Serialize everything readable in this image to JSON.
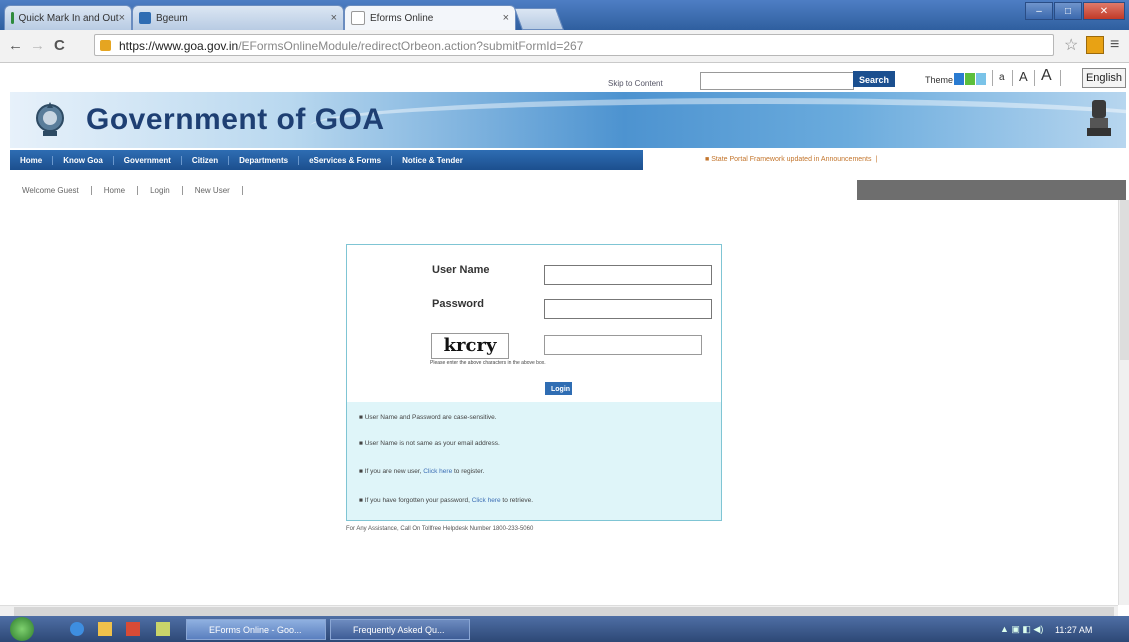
{
  "browser": {
    "tabs": [
      {
        "label": "Quick Mark In and Out"
      },
      {
        "label": "Bgeum"
      },
      {
        "label": "Eforms Online"
      }
    ],
    "url_host": "https://www.goa.gov.in",
    "url_path": "/EFormsOnlineModule/redirectOrbeon.action?submitFormId=267"
  },
  "header": {
    "skip_link": "Skip to Content",
    "search_button": "Search",
    "theme_label": "Theme",
    "theme_colors": [
      "#2a7bd1",
      "#5cbf3c",
      "#7ac3e8"
    ],
    "font_sizes": [
      "a",
      "A",
      "A"
    ],
    "language": "English",
    "site_title": "Government of GOA"
  },
  "nav": {
    "items": [
      "Home",
      "Know Goa",
      "Government",
      "Citizen",
      "Departments",
      "eServices & Forms",
      "Notice & Tender"
    ],
    "notice": "State Portal Framework updated in Announcements"
  },
  "subnav": {
    "welcome": "Welcome Guest",
    "items": [
      "Home",
      "Login",
      "New User"
    ]
  },
  "login": {
    "username_label": "User Name",
    "password_label": "Password",
    "captcha_text": "krcry",
    "captcha_hint": "Please enter the above characters in the above box.",
    "login_button": "Login",
    "info": [
      {
        "text": "User Name and Password are case-sensitive."
      },
      {
        "text": "User Name is not same as your email address."
      },
      {
        "text": "If you are new user, ",
        "link": "Click here",
        "after": " to register."
      },
      {
        "text": "If you have forgotten your password, ",
        "link": "Click here",
        "after": " to retrieve."
      }
    ],
    "helpline": "For Any Assistance, Call On Tollfree Helpdesk Number 1800-233-5060"
  },
  "taskbar": {
    "tasks": [
      "EForms Online - Goo...",
      "Frequently Asked Qu..."
    ],
    "clock": "11:27 AM"
  }
}
